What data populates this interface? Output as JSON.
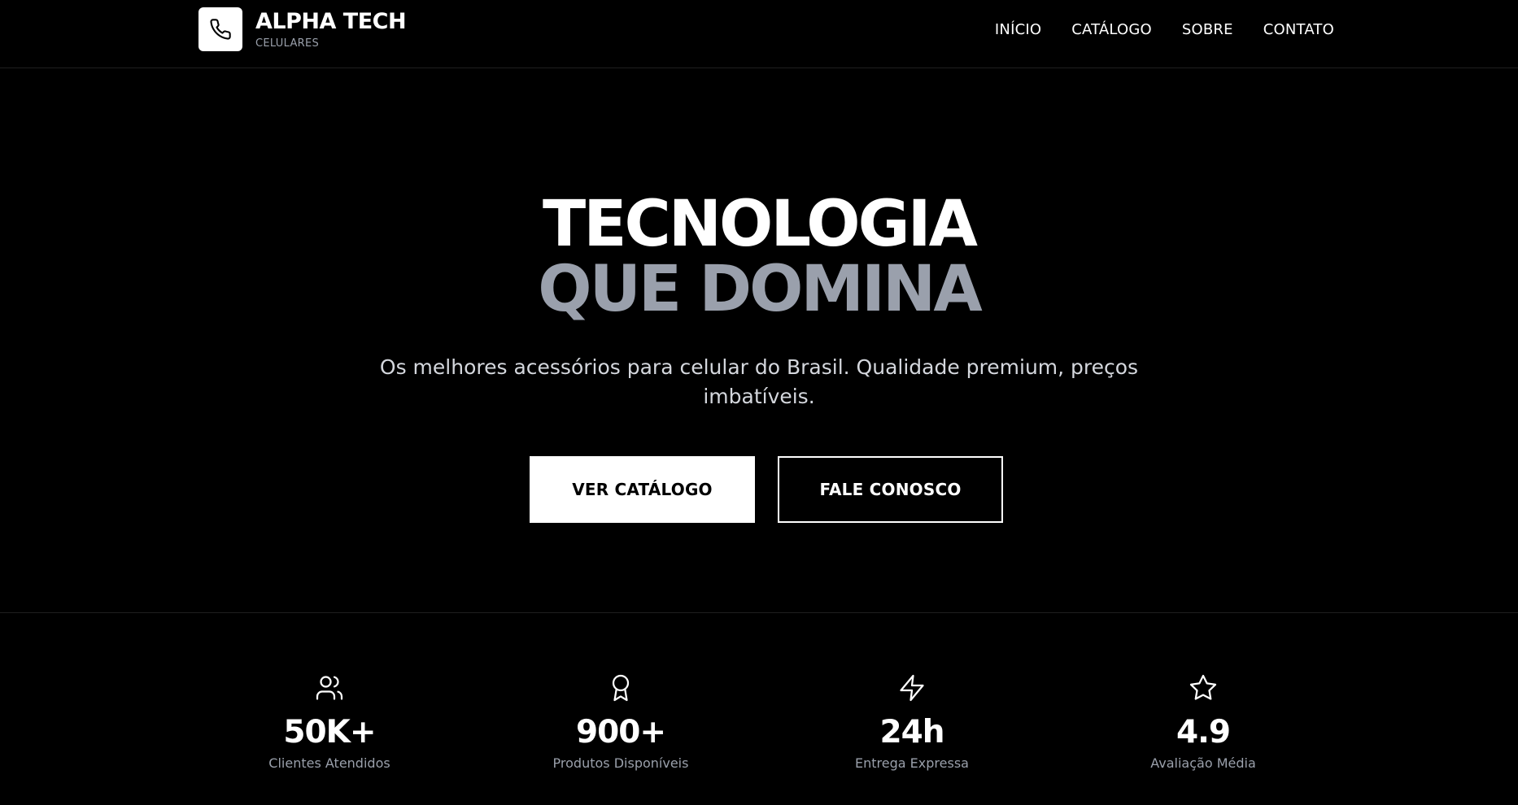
{
  "header": {
    "brand_name": "ALPHA TECH",
    "brand_sub": "CELULARES",
    "logo_icon": "phone-icon",
    "nav": [
      {
        "label": "INÍCIO"
      },
      {
        "label": "CATÁLOGO"
      },
      {
        "label": "SOBRE"
      },
      {
        "label": "CONTATO"
      }
    ]
  },
  "hero": {
    "title_line1": "TECNOLOGIA",
    "title_line2": "QUE DOMINA",
    "subtitle": "Os melhores acessórios para celular do Brasil. Qualidade premium, preços imbatíveis.",
    "primary_button": "VER CATÁLOGO",
    "secondary_button": "FALE CONOSCO"
  },
  "stats": [
    {
      "icon": "users-icon",
      "value": "50K+",
      "label": "Clientes Atendidos"
    },
    {
      "icon": "award-icon",
      "value": "900+",
      "label": "Produtos Disponíveis"
    },
    {
      "icon": "lightning-icon",
      "value": "24h",
      "label": "Entrega Expressa"
    },
    {
      "icon": "star-icon",
      "value": "4.9",
      "label": "Avaliação Média"
    }
  ],
  "colors": {
    "background": "#000000",
    "text": "#ffffff",
    "muted": "#9aa0ab",
    "accent_gray": "#9aa0ac",
    "border": "#1f1f1f"
  }
}
